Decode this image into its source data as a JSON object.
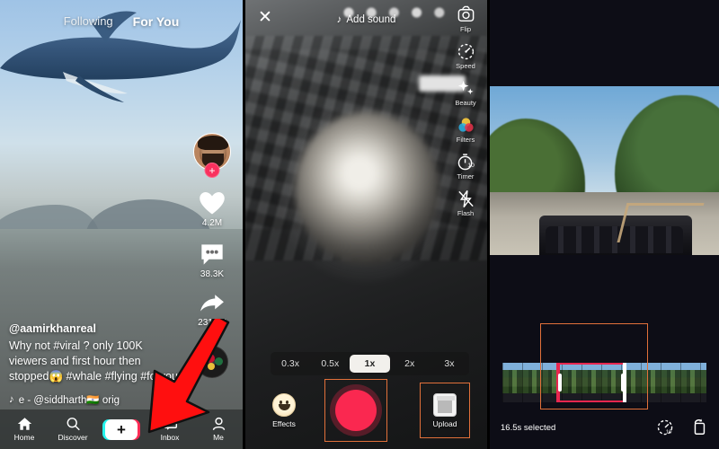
{
  "panels": {
    "feed": {
      "name": "tiktok-feed",
      "tabs": [
        {
          "label": "Following",
          "active": false
        },
        {
          "label": "For You",
          "active": true
        }
      ],
      "rail": {
        "avatar_badge": "+",
        "like": {
          "icon": "heart-icon",
          "count": "4.2M"
        },
        "comment": {
          "icon": "comment-icon",
          "count": "38.3K"
        },
        "share": {
          "icon": "share-arrow-icon",
          "count": "231.4K"
        },
        "disc": "music-disc-icon"
      },
      "caption": {
        "username": "@aamirkhanreal",
        "text": "Why not #viral ? only 100K viewers and first hour then stopped😱 #whale #flying #foryou"
      },
      "music": {
        "icon": "music-note-icon",
        "text": "e - @siddharth🇮🇳   orig"
      },
      "navbar": [
        {
          "label": "Home",
          "icon": "home-icon",
          "active": true
        },
        {
          "label": "Discover",
          "icon": "search-icon",
          "active": false
        },
        {
          "label": "",
          "icon": "plus-create-icon",
          "active": false,
          "glyph": "+"
        },
        {
          "label": "Inbox",
          "icon": "inbox-icon",
          "active": false
        },
        {
          "label": "Me",
          "icon": "person-icon",
          "active": false
        }
      ],
      "annotation": {
        "type": "red-arrow",
        "points_to": "plus-create-icon"
      }
    },
    "camera": {
      "name": "tiktok-camera",
      "close_label": "✕",
      "add_sound": "Add sound",
      "rail": [
        {
          "label": "Flip",
          "icon": "flip-camera-icon"
        },
        {
          "label": "Speed",
          "icon": "speed-icon"
        },
        {
          "label": "Beauty",
          "icon": "beauty-sparkle-icon"
        },
        {
          "label": "Filters",
          "icon": "filters-icon"
        },
        {
          "label": "Timer",
          "icon": "timer-icon"
        },
        {
          "label": "Flash",
          "icon": "flash-off-icon"
        }
      ],
      "zoom_levels": [
        {
          "label": "0.3x",
          "active": false
        },
        {
          "label": "0.5x",
          "active": false
        },
        {
          "label": "1x",
          "active": true
        },
        {
          "label": "2x",
          "active": false
        },
        {
          "label": "3x",
          "active": false
        }
      ],
      "effects_label": "Effects",
      "record_label": "record-button",
      "upload_label": "Upload",
      "highlights": {
        "color": "#e1703a",
        "targets": [
          "record-button",
          "upload-button"
        ]
      }
    },
    "trim": {
      "name": "tiktok-video-trim",
      "selection_text": "16.5s selected",
      "footer_icons": [
        {
          "icon": "speed-adjust-icon"
        },
        {
          "icon": "rotate-icon"
        }
      ],
      "highlight_color": "#e1703a",
      "trim_color": "#e8274f"
    }
  },
  "colors": {
    "tiktok_red": "#fe2c55",
    "tiktok_cyan": "#25f4ee",
    "record_red": "#fa2850",
    "highlight_orange": "#e1703a",
    "arrow_red": "#ff0f0f"
  }
}
